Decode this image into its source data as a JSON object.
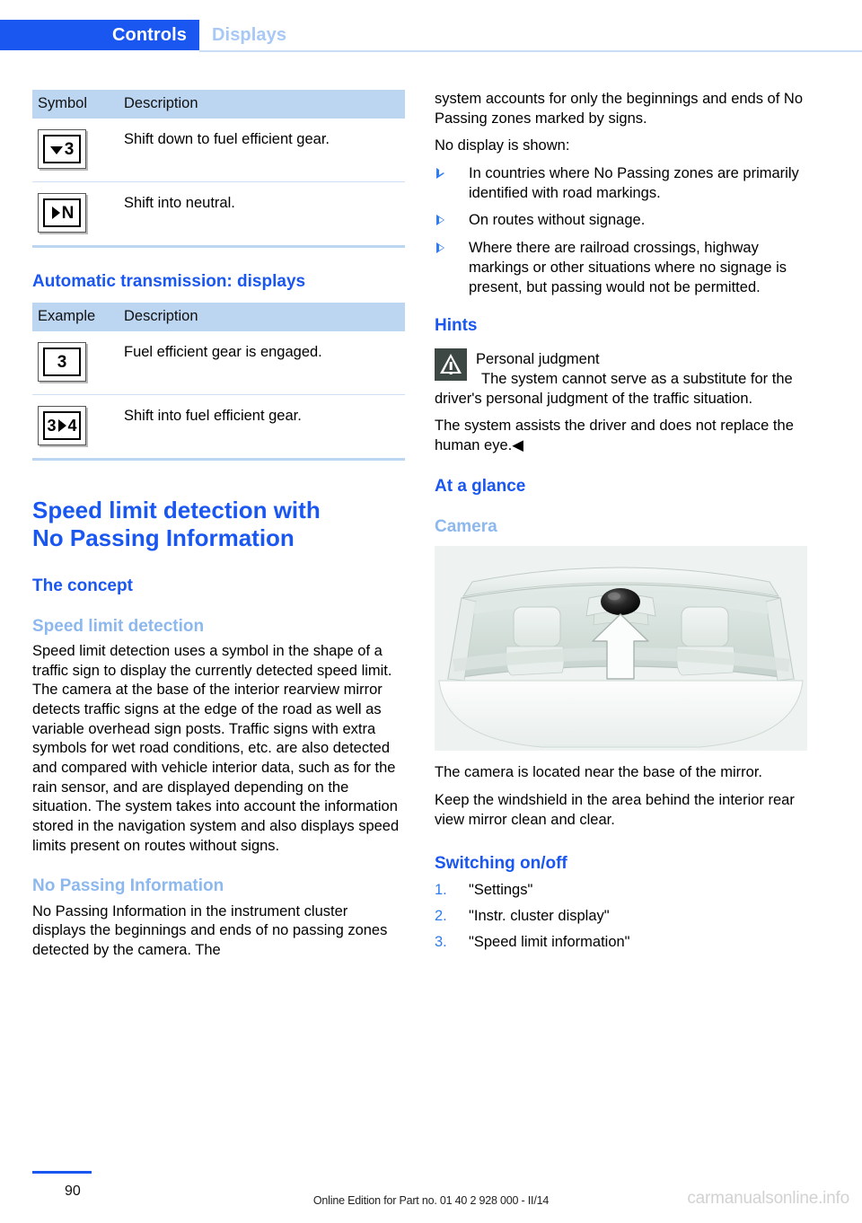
{
  "header": {
    "active_tab": "Controls",
    "inactive_tab": "Displays"
  },
  "left_column": {
    "table_manual": {
      "headers": [
        "Symbol",
        "Description"
      ],
      "rows": [
        {
          "symbol_text": "3",
          "symbol_kind": "arrow-down-gear",
          "description": "Shift down to fuel efficient gear."
        },
        {
          "symbol_text": "N",
          "symbol_kind": "arrow-right-neutral",
          "description": "Shift into neutral."
        }
      ]
    },
    "section_heading": "Automatic transmission: displays",
    "table_auto": {
      "headers": [
        "Example",
        "Description"
      ],
      "rows": [
        {
          "symbol_text": "3",
          "symbol_kind": "plain-gear",
          "description": "Fuel efficient gear is engaged."
        },
        {
          "symbol_left": "3",
          "symbol_right": "4",
          "symbol_kind": "gear-shift-arrow",
          "description": "Shift into fuel efficient gear."
        }
      ]
    },
    "title": "Speed limit detection with No Passing Information",
    "title_line1": "Speed limit detection with",
    "title_line2": "No Passing Information",
    "concept_heading": "The concept",
    "sld_heading": "Speed limit detection",
    "sld_paragraph": "Speed limit detection uses a symbol in the shape of a traffic sign to display the currently detected speed limit. The camera at the base of the interior rearview mirror detects traffic signs at the edge of the road as well as variable overhead sign posts. Traffic signs with extra symbols for wet road conditions, etc. are also detected and compared with vehicle interior data, such as for the rain sensor, and are displayed depending on the situation. The system takes into account the information stored in the navigation system and also displays speed limits present on routes without signs.",
    "npi_heading": "No Passing Information",
    "npi_paragraph": "No Passing Information in the instrument cluster displays the beginnings and ends of no passing zones detected by the camera. The"
  },
  "right_column": {
    "continued_paragraph": "system accounts for only the beginnings and ends of No Passing zones marked by signs.",
    "no_display_lead": "No display is shown:",
    "no_display_items": [
      "In countries where No Passing zones are primarily identified with road markings.",
      "On routes without signage.",
      "Where there are railroad crossings, highway markings or other situations where no signage is present, but passing would not be permitted."
    ],
    "hints_heading": "Hints",
    "warning_title": "Personal judgment",
    "warning_body": "The system cannot serve as a substitute for the driver's personal judgment of the traffic situation.",
    "warning_paragraph2": "The system assists the driver and does not replace the human eye.◀",
    "at_a_glance_heading": "At a glance",
    "camera_heading": "Camera",
    "camera_figure_alt": "windshield-interior-camera-illustration",
    "camera_paragraph1": "The camera is located near the base of the mirror.",
    "camera_paragraph2": "Keep the windshield in the area behind the interior rear view mirror clean and clear.",
    "switching_heading": "Switching on/off",
    "switching_steps": [
      {
        "index": "1.",
        "label": "\"Settings\""
      },
      {
        "index": "2.",
        "label": "\"Instr. cluster display\""
      },
      {
        "index": "3.",
        "label": "\"Speed limit information\""
      }
    ]
  },
  "footer": {
    "page_number": "90",
    "edition_text": "Online Edition for Part no. 01 40 2 928 000 - II/14",
    "watermark": "carmanualsonline.info"
  },
  "colors": {
    "accent_blue": "#1a56f0",
    "light_blue": "#8cb8ee",
    "table_header_bg": "#bcd6f2",
    "warning_icon_bg": "#3d4744"
  }
}
